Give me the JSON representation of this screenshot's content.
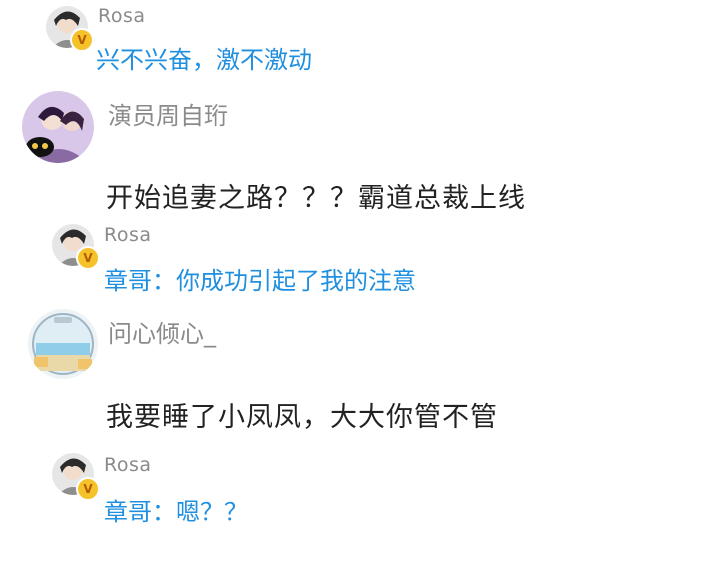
{
  "thread": [
    {
      "type": "reply",
      "user": "Rosa",
      "text": "兴不兴奋，激不激动",
      "verified_badge": "V"
    },
    {
      "type": "comment",
      "user": "演员周自珩",
      "text": "开始追妻之路？？？霸道总裁上线"
    },
    {
      "type": "reply",
      "user": "Rosa",
      "text": "章哥：你成功引起了我的注意",
      "verified_badge": "V"
    },
    {
      "type": "comment",
      "user": "问心倾心_",
      "text": "我要睡了小凤凤，大大你管不管"
    },
    {
      "type": "reply",
      "user": "Rosa",
      "text": "章哥：嗯？？",
      "verified_badge": "V"
    }
  ],
  "colors": {
    "reply_text": "#1f8fe0",
    "username": "#8a8a8a",
    "comment_text": "#222222",
    "badge": "#f6c22b"
  }
}
